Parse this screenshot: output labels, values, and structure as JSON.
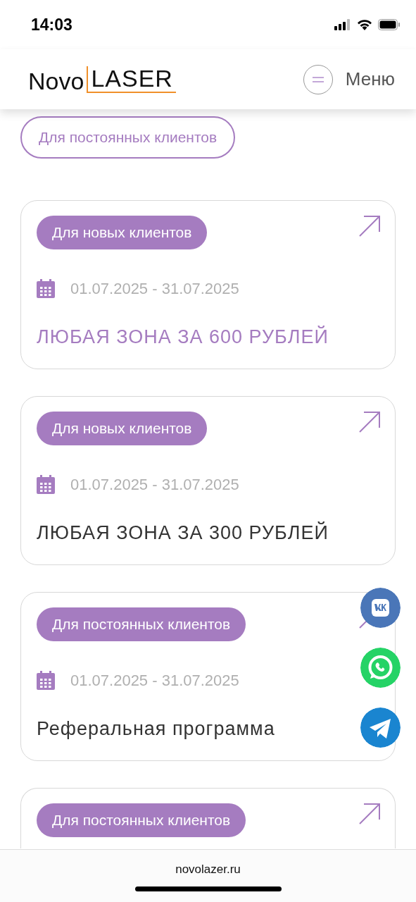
{
  "status_bar": {
    "time": "14:03"
  },
  "header": {
    "logo": {
      "first": "Novo",
      "second": "LASER"
    },
    "menu_label": "Меню"
  },
  "filter": {
    "label": "Для постоянных клиентов"
  },
  "cards": [
    {
      "tag": "Для новых клиентов",
      "dates": "01.07.2025 - 31.07.2025",
      "title": "ЛЮБАЯ ЗОНА ЗА 600 РУБЛЕЙ",
      "highlighted": true
    },
    {
      "tag": "Для новых клиентов",
      "dates": "01.07.2025 - 31.07.2025",
      "title": "ЛЮБАЯ ЗОНА ЗА 300 РУБЛЕЙ",
      "highlighted": false
    },
    {
      "tag": "Для постоянных клиентов",
      "dates": "01.07.2025 - 31.07.2025",
      "title": "Реферальная программа",
      "highlighted": false
    },
    {
      "tag": "Для постоянных клиентов"
    }
  ],
  "social": [
    {
      "kind": "vk"
    },
    {
      "kind": "whatsapp"
    },
    {
      "kind": "telegram"
    }
  ],
  "browser_bar": {
    "url": "novolazer.ru"
  }
}
